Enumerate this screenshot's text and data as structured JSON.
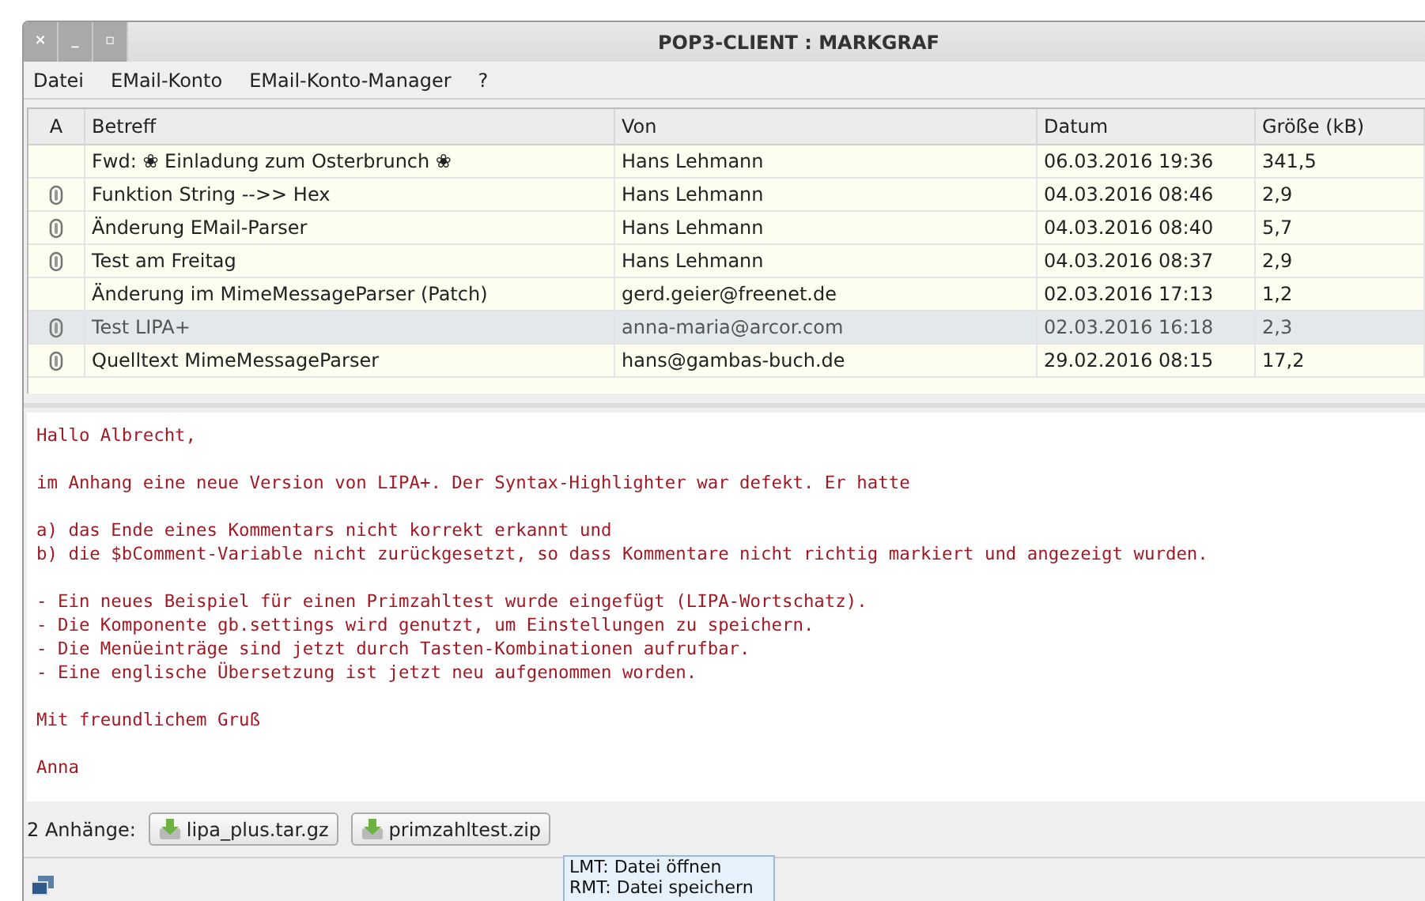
{
  "window": {
    "title": "POP3-CLIENT : MARKGRAF",
    "controls": [
      "×",
      "_",
      "▫"
    ]
  },
  "menu": [
    "Datei",
    "EMail-Konto",
    "EMail-Konto-Manager",
    "?"
  ],
  "table": {
    "columns": [
      "A",
      "Betreff",
      "Von",
      "Datum",
      "Größe (kB)"
    ],
    "rows": [
      {
        "attachment": false,
        "selected": false,
        "subject": "Fwd: ❀ Einladung zum Osterbrunch ❀",
        "from": "Hans Lehmann",
        "date": "06.03.2016 19:36",
        "size": "341,5"
      },
      {
        "attachment": true,
        "selected": false,
        "subject": "Funktion String -->> Hex",
        "from": "Hans Lehmann",
        "date": "04.03.2016 08:46",
        "size": "2,9"
      },
      {
        "attachment": true,
        "selected": false,
        "subject": "Änderung EMail-Parser",
        "from": "Hans Lehmann",
        "date": "04.03.2016 08:40",
        "size": "5,7"
      },
      {
        "attachment": true,
        "selected": false,
        "subject": "Test am Freitag",
        "from": "Hans Lehmann",
        "date": "04.03.2016 08:37",
        "size": "2,9"
      },
      {
        "attachment": false,
        "selected": false,
        "subject": "Änderung im MimeMessageParser (Patch)",
        "from": "gerd.geier@freenet.de",
        "date": "02.03.2016 17:13",
        "size": "1,2"
      },
      {
        "attachment": true,
        "selected": true,
        "subject": "Test LIPA+",
        "from": "anna-maria@arcor.com",
        "date": "02.03.2016 16:18",
        "size": "2,3"
      },
      {
        "attachment": true,
        "selected": false,
        "subject": "Quelltext MimeMessageParser",
        "from": "hans@gambas-buch.de",
        "date": "29.02.2016 08:15",
        "size": "17,2"
      }
    ]
  },
  "message": {
    "paragraphs": [
      [
        "Hallo Albrecht,"
      ],
      [
        "im Anhang eine neue Version von LIPA+. Der Syntax-Highlighter war defekt. Er hatte"
      ],
      [
        "a) das Ende eines Kommentars nicht korrekt erkannt und",
        "b) die $bComment-Variable nicht zurückgesetzt, so dass Kommentare nicht richtig markiert und angezeigt wurden."
      ],
      [
        "- Ein neues Beispiel für einen Primzahltest wurde eingefügt (LIPA-Wortschatz).",
        "- Die Komponente gb.settings wird genutzt, um Einstellungen zu speichern.",
        "- Die Menüeinträge sind jetzt durch Tasten-Kombinationen aufrufbar.",
        "- Eine englische Übersetzung ist jetzt neu aufgenommen worden."
      ],
      [
        "Mit freundlichem Gruß"
      ],
      [
        "Anna"
      ]
    ]
  },
  "attachments": {
    "label": "2 Anhänge:",
    "files": [
      "lipa_plus.tar.gz",
      "primzahltest.zip"
    ]
  },
  "tooltip": [
    "LMT: Datei öffnen",
    "RMT: Datei speichern"
  ]
}
